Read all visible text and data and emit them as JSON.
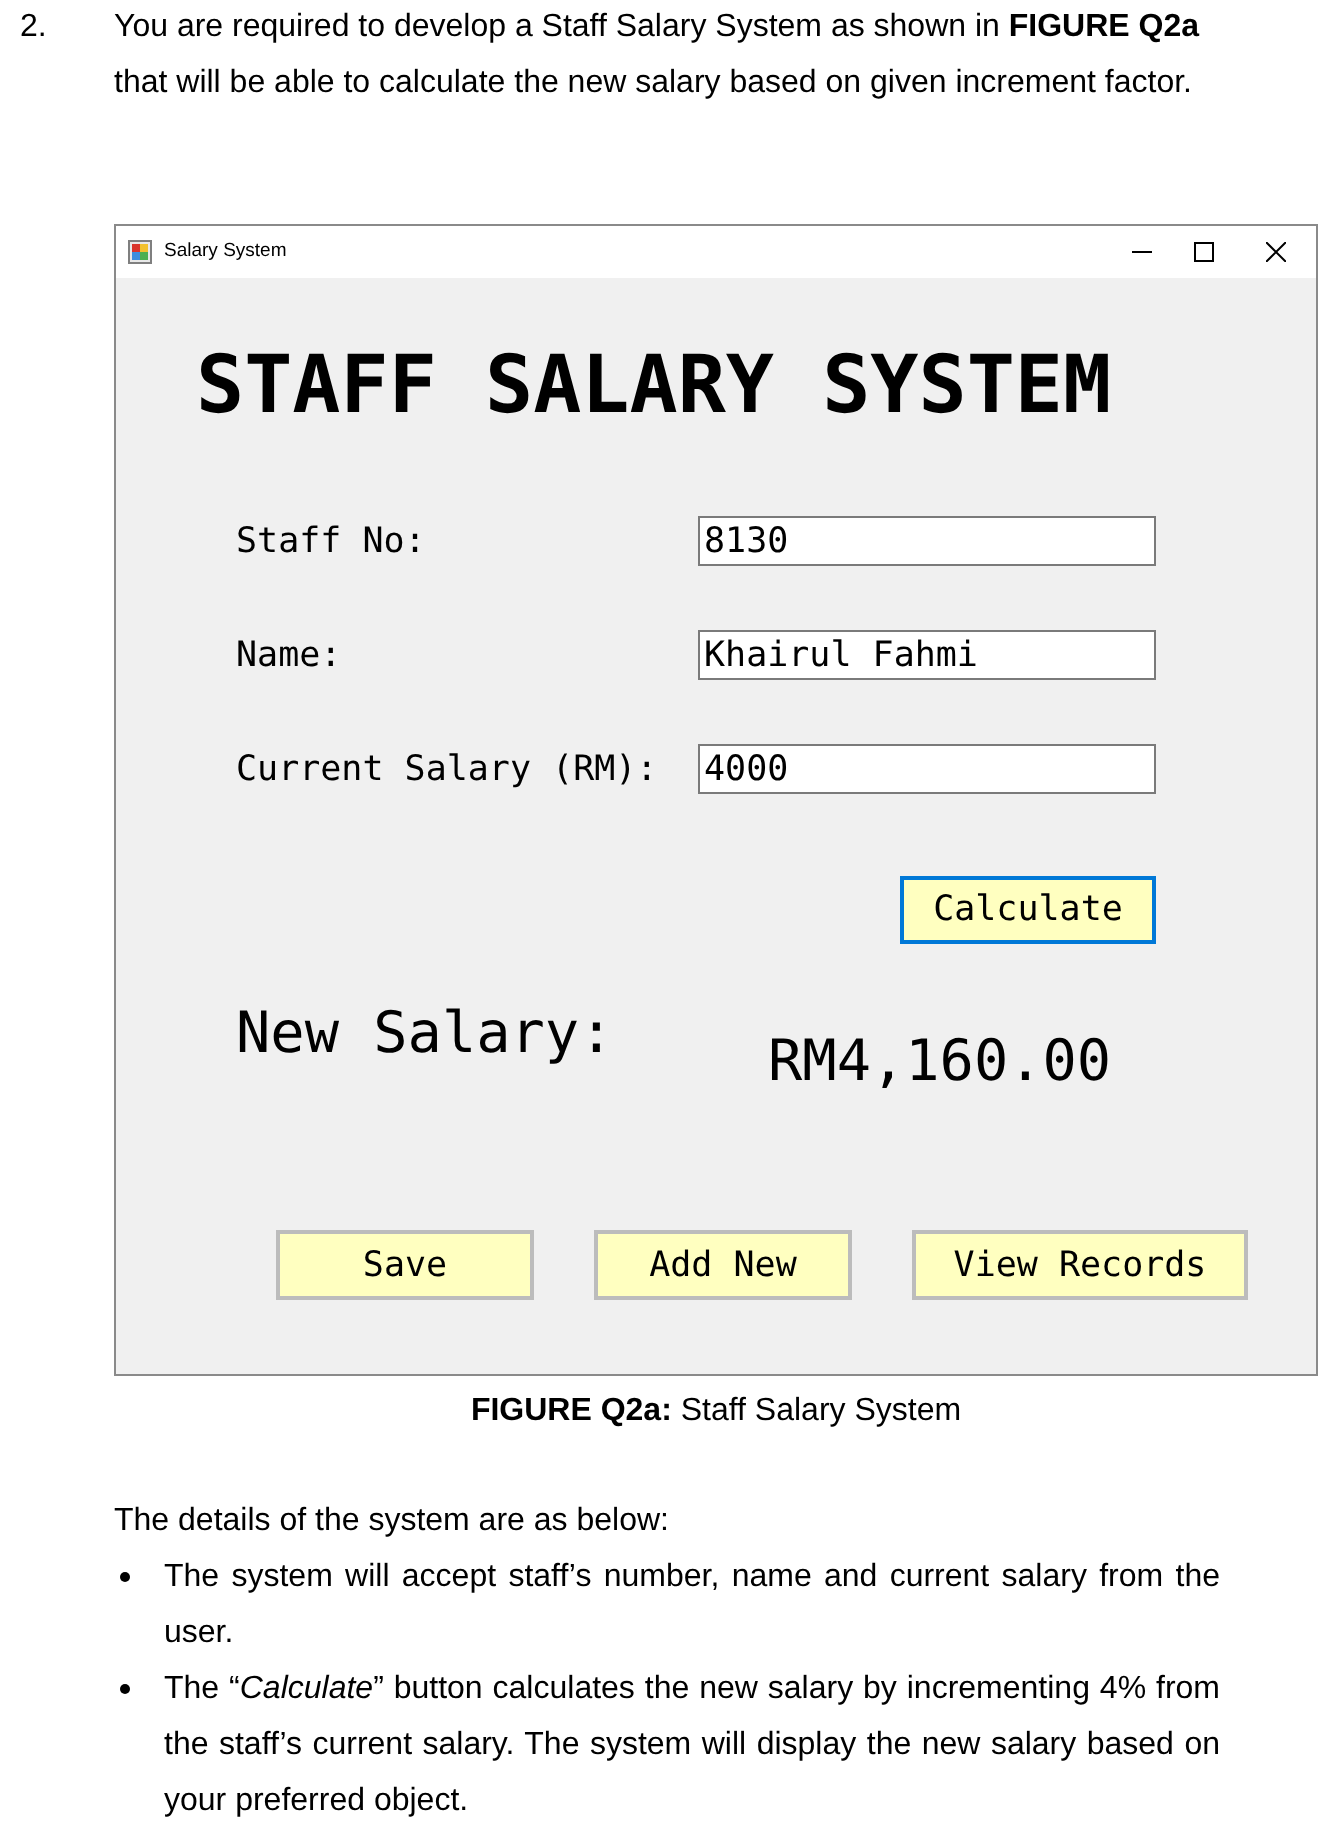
{
  "question": {
    "number": "2.",
    "text": "You are required to develop a Staff Salary System as shown in **FIGURE Q2a** that will be able to calculate the new salary based on given increment factor."
  },
  "window": {
    "title": "Salary System",
    "heading": "STAFF SALARY SYSTEM",
    "fields": [
      {
        "label": "Staff No:",
        "value": "8130"
      },
      {
        "label": "Name:",
        "value": "Khairul Fahmi"
      },
      {
        "label": "Current Salary (RM):",
        "value": "4000"
      }
    ],
    "calculate_button": {
      "label": "Calculate",
      "focused": true
    },
    "result": {
      "label": "New Salary:",
      "value": "RM4,160.00"
    },
    "buttons": [
      {
        "label": "Save",
        "focused": false
      },
      {
        "label": "Add New",
        "focused": false
      },
      {
        "label": "View Records",
        "focused": false
      }
    ]
  },
  "caption": "**FIGURE Q2a:** Staff Salary System",
  "details": {
    "intro": "The details of the system are as below:",
    "bullets": [
      "The system will accept staff’s number, name and current salary from the user.",
      "The “*Calculate*” button calculates the new salary by incrementing 4% from the staff’s current salary. The system will display the new salary based on your preferred object."
    ]
  }
}
